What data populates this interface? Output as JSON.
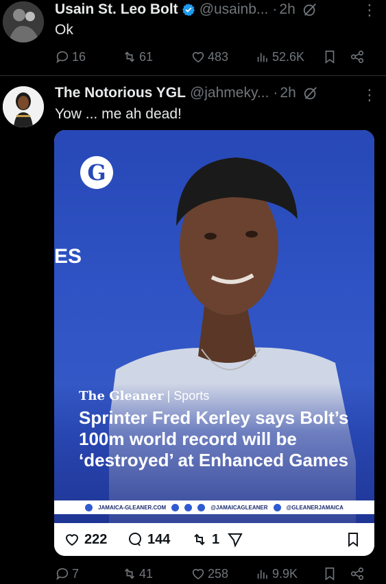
{
  "tweets": [
    {
      "name": "Usain St. Leo Bolt",
      "handle": "@usainb...",
      "dot": "·",
      "time": "2h",
      "text": "Ok",
      "actions": {
        "replies": "16",
        "reposts": "61",
        "likes": "483",
        "views": "52.6K"
      }
    },
    {
      "name": "The Notorious YGL",
      "handle": "@jahmeky...",
      "dot": "·",
      "time": "2h",
      "text": "Yow ... me ah dead!",
      "card": {
        "logo_letter": "G",
        "background_text": "ES",
        "brand": "The Gleaner",
        "section": "| Sports",
        "headline": "Sprinter Fred Kerley says Bolt’s 100m world record will be ‘destroyed’ at Enhanced Games",
        "footer": {
          "site": "JAMAICA-GLEANER.COM",
          "handle1": "@JAMAICAGLEANER",
          "handle2": "@GLEANERJAMAICA"
        },
        "stats": {
          "likes": "222",
          "comments": "144",
          "reposts": "1"
        }
      },
      "actions": {
        "replies": "7",
        "reposts": "41",
        "likes": "258",
        "views": "9.9K"
      }
    }
  ],
  "colors": {
    "background": "#000000",
    "muted": "#71767b",
    "verified": "#1d9bf0",
    "card_blue": "#2f53c4"
  }
}
